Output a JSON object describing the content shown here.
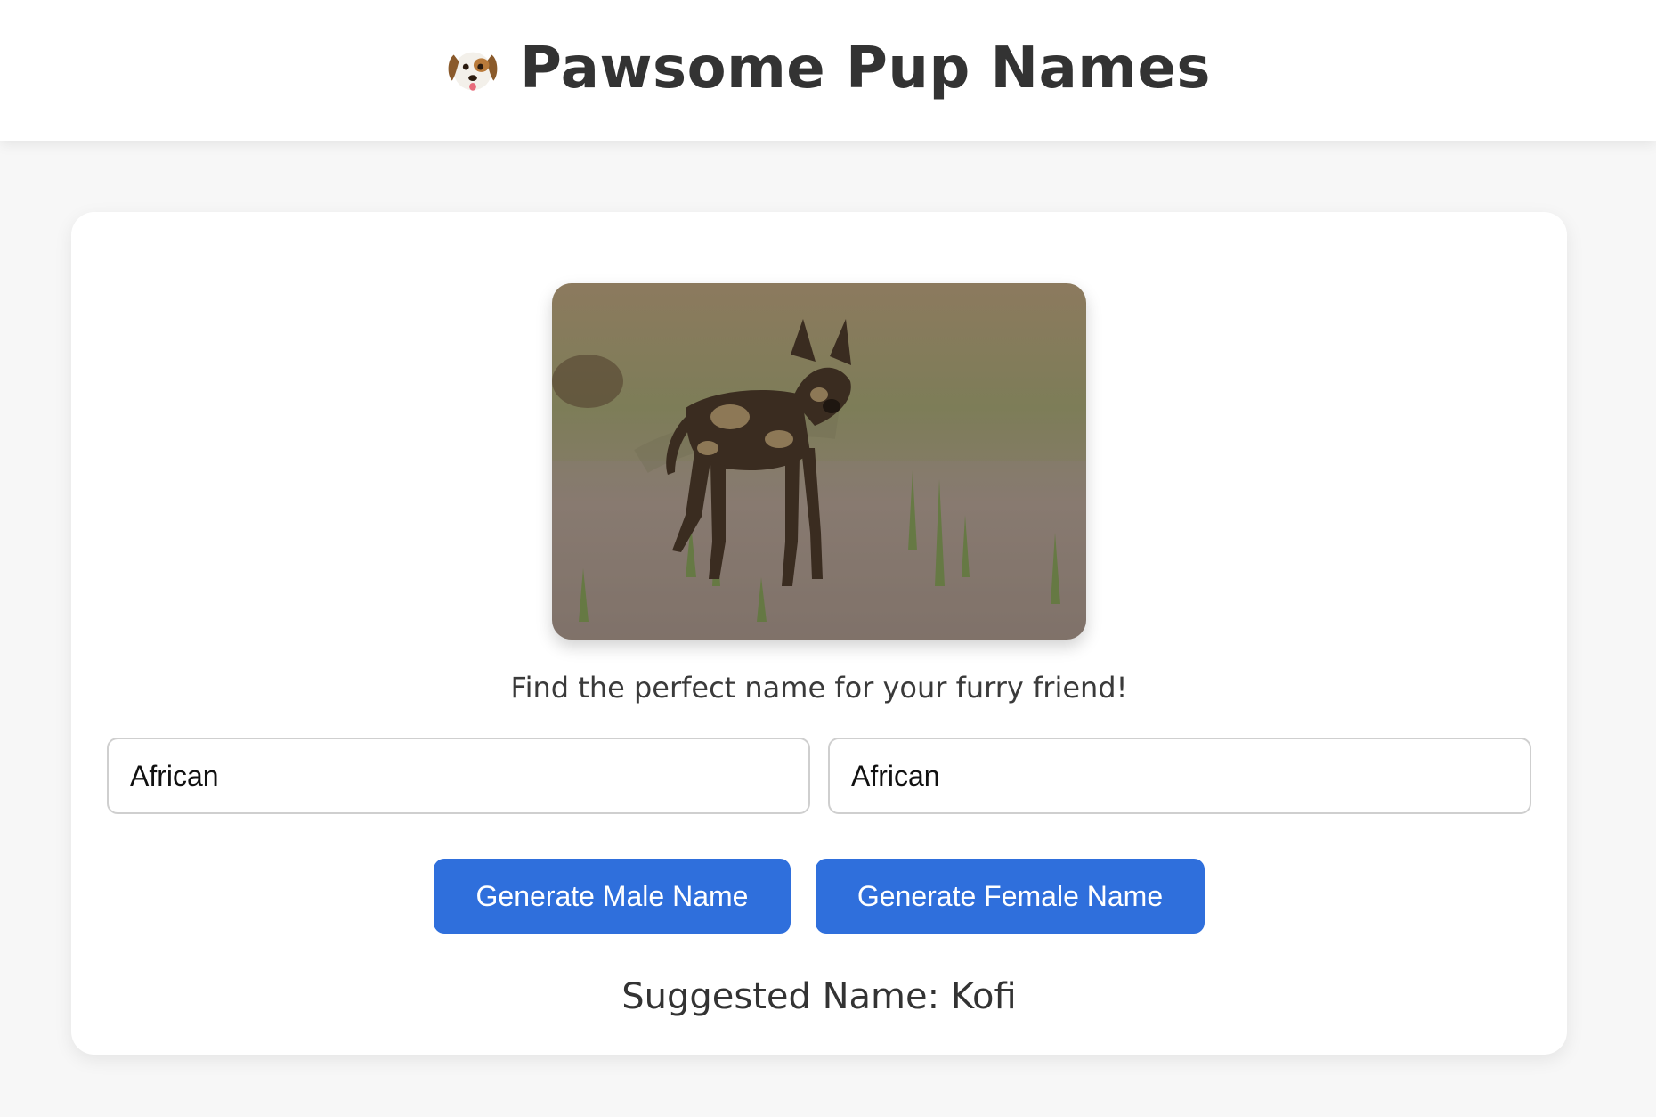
{
  "header": {
    "icon": "dog-face-icon",
    "title": "Pawsome Pup Names"
  },
  "main": {
    "image_alt": "African wild dog",
    "tagline": "Find the perfect name for your furry friend!",
    "inputs": [
      {
        "value": "African"
      },
      {
        "value": "African"
      }
    ],
    "buttons": {
      "male": "Generate Male Name",
      "female": "Generate Female Name"
    },
    "result": "Suggested Name: Kofi"
  },
  "colors": {
    "accent": "#2f6fdc",
    "background": "#f7f7f7",
    "card": "#ffffff",
    "text": "#333333"
  }
}
